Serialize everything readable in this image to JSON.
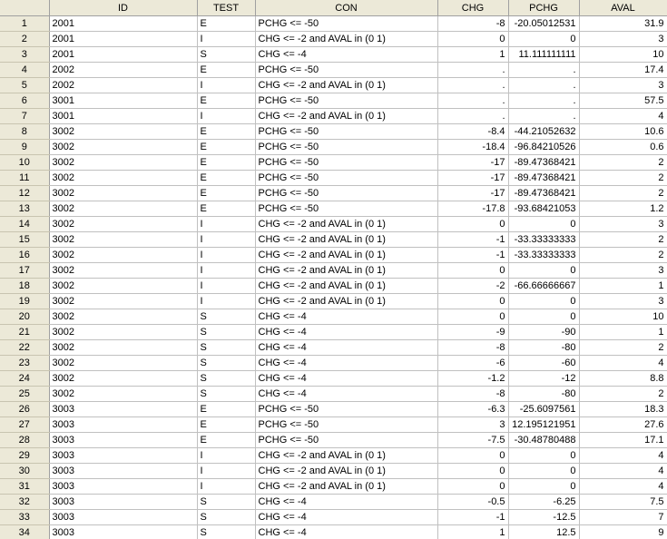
{
  "columns": [
    {
      "key": "row",
      "label": ""
    },
    {
      "key": "id",
      "label": "ID"
    },
    {
      "key": "test",
      "label": "TEST"
    },
    {
      "key": "con",
      "label": "CON"
    },
    {
      "key": "chg",
      "label": "CHG"
    },
    {
      "key": "pchg",
      "label": "PCHG"
    },
    {
      "key": "aval",
      "label": "AVAL"
    }
  ],
  "rows": [
    {
      "n": "1",
      "id": "2001",
      "test": "E",
      "con": "PCHG <= -50",
      "chg": "-8",
      "pchg": "-20.05012531",
      "aval": "31.9"
    },
    {
      "n": "2",
      "id": "2001",
      "test": "I",
      "con": "CHG <= -2 and AVAL in (0 1)",
      "chg": "0",
      "pchg": "0",
      "aval": "3"
    },
    {
      "n": "3",
      "id": "2001",
      "test": "S",
      "con": "CHG <= -4",
      "chg": "1",
      "pchg": "11.111111111",
      "aval": "10"
    },
    {
      "n": "4",
      "id": "2002",
      "test": "E",
      "con": "PCHG <= -50",
      "chg": ".",
      "pchg": ".",
      "aval": "17.4"
    },
    {
      "n": "5",
      "id": "2002",
      "test": "I",
      "con": "CHG <= -2 and AVAL in (0 1)",
      "chg": ".",
      "pchg": ".",
      "aval": "3"
    },
    {
      "n": "6",
      "id": "3001",
      "test": "E",
      "con": "PCHG <= -50",
      "chg": ".",
      "pchg": ".",
      "aval": "57.5"
    },
    {
      "n": "7",
      "id": "3001",
      "test": "I",
      "con": "CHG <= -2 and AVAL in (0 1)",
      "chg": ".",
      "pchg": ".",
      "aval": "4"
    },
    {
      "n": "8",
      "id": "3002",
      "test": "E",
      "con": "PCHG <= -50",
      "chg": "-8.4",
      "pchg": "-44.21052632",
      "aval": "10.6"
    },
    {
      "n": "9",
      "id": "3002",
      "test": "E",
      "con": "PCHG <= -50",
      "chg": "-18.4",
      "pchg": "-96.84210526",
      "aval": "0.6"
    },
    {
      "n": "10",
      "id": "3002",
      "test": "E",
      "con": "PCHG <= -50",
      "chg": "-17",
      "pchg": "-89.47368421",
      "aval": "2"
    },
    {
      "n": "11",
      "id": "3002",
      "test": "E",
      "con": "PCHG <= -50",
      "chg": "-17",
      "pchg": "-89.47368421",
      "aval": "2"
    },
    {
      "n": "12",
      "id": "3002",
      "test": "E",
      "con": "PCHG <= -50",
      "chg": "-17",
      "pchg": "-89.47368421",
      "aval": "2"
    },
    {
      "n": "13",
      "id": "3002",
      "test": "E",
      "con": "PCHG <= -50",
      "chg": "-17.8",
      "pchg": "-93.68421053",
      "aval": "1.2"
    },
    {
      "n": "14",
      "id": "3002",
      "test": "I",
      "con": "CHG <= -2 and AVAL in (0 1)",
      "chg": "0",
      "pchg": "0",
      "aval": "3"
    },
    {
      "n": "15",
      "id": "3002",
      "test": "I",
      "con": "CHG <= -2 and AVAL in (0 1)",
      "chg": "-1",
      "pchg": "-33.33333333",
      "aval": "2"
    },
    {
      "n": "16",
      "id": "3002",
      "test": "I",
      "con": "CHG <= -2 and AVAL in (0 1)",
      "chg": "-1",
      "pchg": "-33.33333333",
      "aval": "2"
    },
    {
      "n": "17",
      "id": "3002",
      "test": "I",
      "con": "CHG <= -2 and AVAL in (0 1)",
      "chg": "0",
      "pchg": "0",
      "aval": "3"
    },
    {
      "n": "18",
      "id": "3002",
      "test": "I",
      "con": "CHG <= -2 and AVAL in (0 1)",
      "chg": "-2",
      "pchg": "-66.66666667",
      "aval": "1"
    },
    {
      "n": "19",
      "id": "3002",
      "test": "I",
      "con": "CHG <= -2 and AVAL in (0 1)",
      "chg": "0",
      "pchg": "0",
      "aval": "3"
    },
    {
      "n": "20",
      "id": "3002",
      "test": "S",
      "con": "CHG <= -4",
      "chg": "0",
      "pchg": "0",
      "aval": "10"
    },
    {
      "n": "21",
      "id": "3002",
      "test": "S",
      "con": "CHG <= -4",
      "chg": "-9",
      "pchg": "-90",
      "aval": "1"
    },
    {
      "n": "22",
      "id": "3002",
      "test": "S",
      "con": "CHG <= -4",
      "chg": "-8",
      "pchg": "-80",
      "aval": "2"
    },
    {
      "n": "23",
      "id": "3002",
      "test": "S",
      "con": "CHG <= -4",
      "chg": "-6",
      "pchg": "-60",
      "aval": "4"
    },
    {
      "n": "24",
      "id": "3002",
      "test": "S",
      "con": "CHG <= -4",
      "chg": "-1.2",
      "pchg": "-12",
      "aval": "8.8"
    },
    {
      "n": "25",
      "id": "3002",
      "test": "S",
      "con": "CHG <= -4",
      "chg": "-8",
      "pchg": "-80",
      "aval": "2"
    },
    {
      "n": "26",
      "id": "3003",
      "test": "E",
      "con": "PCHG <= -50",
      "chg": "-6.3",
      "pchg": "-25.6097561",
      "aval": "18.3"
    },
    {
      "n": "27",
      "id": "3003",
      "test": "E",
      "con": "PCHG <= -50",
      "chg": "3",
      "pchg": "12.195121951",
      "aval": "27.6"
    },
    {
      "n": "28",
      "id": "3003",
      "test": "E",
      "con": "PCHG <= -50",
      "chg": "-7.5",
      "pchg": "-30.48780488",
      "aval": "17.1"
    },
    {
      "n": "29",
      "id": "3003",
      "test": "I",
      "con": "CHG <= -2 and AVAL in (0 1)",
      "chg": "0",
      "pchg": "0",
      "aval": "4"
    },
    {
      "n": "30",
      "id": "3003",
      "test": "I",
      "con": "CHG <= -2 and AVAL in (0 1)",
      "chg": "0",
      "pchg": "0",
      "aval": "4"
    },
    {
      "n": "31",
      "id": "3003",
      "test": "I",
      "con": "CHG <= -2 and AVAL in (0 1)",
      "chg": "0",
      "pchg": "0",
      "aval": "4"
    },
    {
      "n": "32",
      "id": "3003",
      "test": "S",
      "con": "CHG <= -4",
      "chg": "-0.5",
      "pchg": "-6.25",
      "aval": "7.5"
    },
    {
      "n": "33",
      "id": "3003",
      "test": "S",
      "con": "CHG <= -4",
      "chg": "-1",
      "pchg": "-12.5",
      "aval": "7"
    },
    {
      "n": "34",
      "id": "3003",
      "test": "S",
      "con": "CHG <= -4",
      "chg": "1",
      "pchg": "12.5",
      "aval": "9"
    }
  ]
}
